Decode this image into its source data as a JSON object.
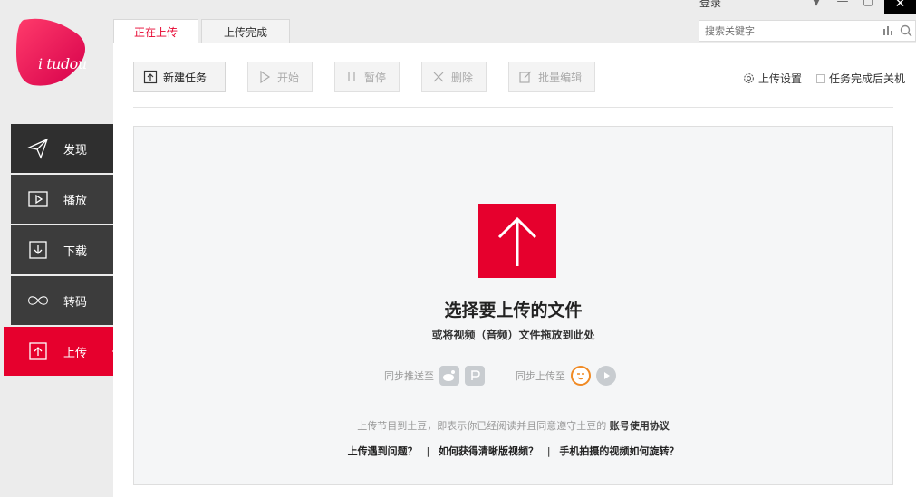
{
  "app": {
    "logo_text": "i tudou"
  },
  "window": {
    "login_label": "登录",
    "close_symbol": "✕",
    "minimize_symbol": "—",
    "restore_symbol": "▢",
    "dropdown_symbol": "▼"
  },
  "search": {
    "placeholder": "搜索关键字"
  },
  "tabs": [
    {
      "label": "正在上传",
      "active": true
    },
    {
      "label": "上传完成",
      "active": false
    }
  ],
  "sidebar": {
    "items": [
      {
        "label": "发现",
        "icon": "paper-plane-icon"
      },
      {
        "label": "播放",
        "icon": "play-box-icon"
      },
      {
        "label": "下载",
        "icon": "download-icon"
      },
      {
        "label": "转码",
        "icon": "infinity-icon"
      },
      {
        "label": "上传",
        "icon": "upload-icon",
        "active": true
      }
    ]
  },
  "toolbar": {
    "new_task": "新建任务",
    "start": "开始",
    "pause": "暂停",
    "delete": "删除",
    "batch_edit": "批量编辑"
  },
  "settings": {
    "upload_settings": "上传设置",
    "shutdown_after": "任务完成后关机"
  },
  "dropzone": {
    "title": "选择要上传的文件",
    "subtitle": "或将视频（音频）文件拖放到此处",
    "sync_push_label": "同步推送至",
    "sync_upload_label": "同步上传至",
    "agreement_text": "上传节目到土豆，即表示你已经阅读并且同意遵守土豆的",
    "agreement_link": "账号使用协议",
    "link_1": "上传遇到问题？",
    "link_2": "如何获得清晰版视频？",
    "link_3": "手机拍摄的视频如何旋转？",
    "separator": "|"
  },
  "colors": {
    "brand": "#e6002d",
    "sidebar_dark": "#3c3c3c"
  }
}
